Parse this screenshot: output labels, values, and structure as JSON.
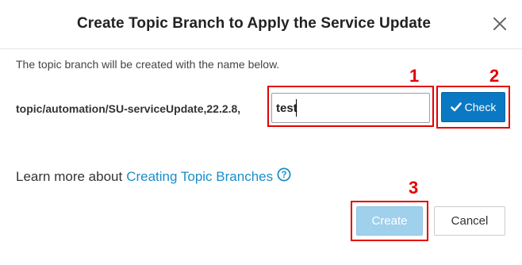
{
  "dialog": {
    "title": "Create Topic Branch to Apply the Service Update",
    "close_icon": "close-icon",
    "description": "The topic branch will be created with the name below.",
    "branch_prefix": "topic/automation/SU-serviceUpdate,22.2.8,",
    "branch_name_value": "test",
    "check_label": "Check",
    "check_icon": "checkmark-icon",
    "learn_more_text": "Learn more about",
    "learn_more_link": "Creating Topic Branches",
    "help_icon": "question-circle-icon",
    "create_label": "Create",
    "cancel_label": "Cancel"
  },
  "annotations": [
    {
      "number": "1"
    },
    {
      "number": "2"
    },
    {
      "number": "3"
    }
  ],
  "colors": {
    "accent": "#0a78c2",
    "link": "#1a8ec9",
    "disabled_button": "#9fd0ec",
    "annotation": "#e30000"
  }
}
